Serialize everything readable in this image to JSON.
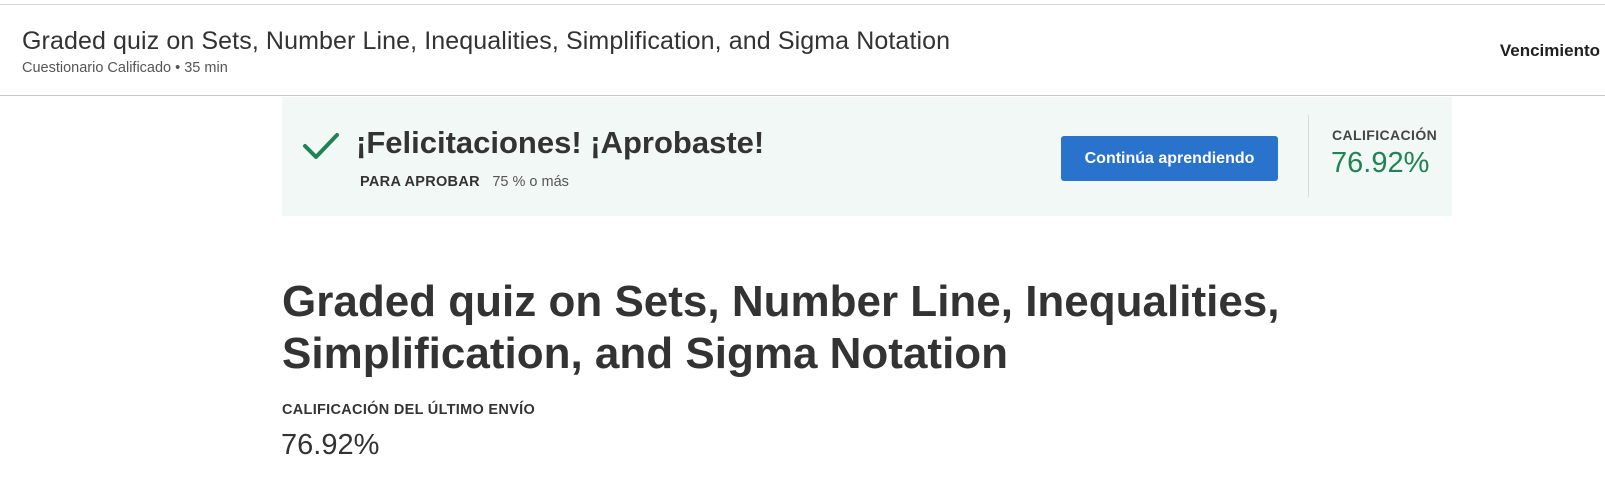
{
  "header": {
    "title": "Graded quiz on Sets, Number Line, Inequalities, Simplification, and Sigma Notation",
    "subtitle": "Cuestionario Calificado • 35 min",
    "due_label": "Vencimiento"
  },
  "banner": {
    "heading": "¡Felicitaciones! ¡Aprobaste!",
    "pass_label": "PARA APROBAR",
    "pass_value": "75 % o más",
    "continue_label": "Continúa aprendiendo",
    "grade_label": "CALIFICACIÓN",
    "grade_value": "76.92%",
    "success_color": "#1f8354",
    "button_color": "#2a73cc"
  },
  "main": {
    "title": "Graded quiz on Sets, Number Line, Inequalities, Simplification, and Sigma Notation",
    "last_submission_label": "CALIFICACIÓN DEL ÚLTIMO ENVÍO",
    "last_submission_value": "76.92%"
  },
  "icons": {
    "check": "checkmark-icon"
  }
}
